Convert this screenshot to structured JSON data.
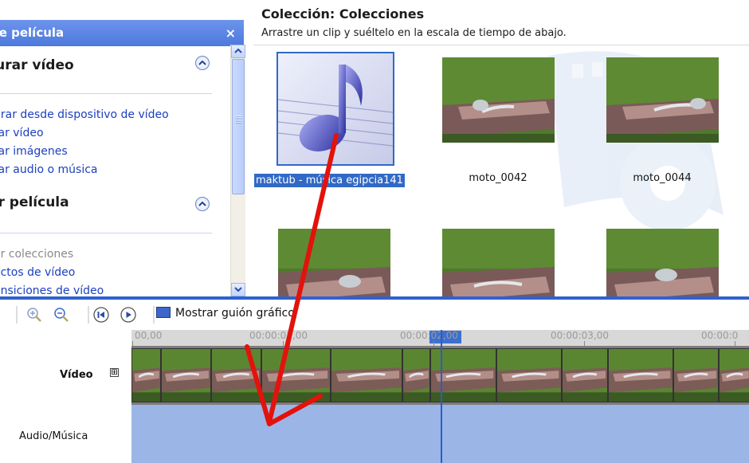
{
  "tasks_pane": {
    "header_title": "de película",
    "close_label": "×",
    "section1": {
      "title": "turar vídeo",
      "items": [
        "urar desde dispositivo de vídeo",
        "tar vídeo",
        "tar imágenes",
        "tar audio o música"
      ]
    },
    "section2": {
      "title": "ar película",
      "items": [
        "ar colecciones",
        "ectos de vídeo",
        "ansiciones de vídeo"
      ]
    }
  },
  "collection": {
    "title": "Colección: Colecciones",
    "subtitle": "Arrastre un clip y suéltelo en la escala de tiempo de abajo.",
    "clips": [
      {
        "name": "maktub - música egipcia141",
        "kind": "audio",
        "selected": true
      },
      {
        "name": "moto_0042",
        "kind": "video"
      },
      {
        "name": "moto_0044",
        "kind": "video"
      },
      {
        "name": "",
        "kind": "video"
      },
      {
        "name": "",
        "kind": "video"
      },
      {
        "name": "",
        "kind": "video"
      }
    ]
  },
  "toolbar": {
    "storyboard_label": "Mostrar guión gráfico"
  },
  "timeline": {
    "ruler_ticks": [
      "00,00",
      "00:00:01,00",
      "00:00:02,00",
      "00:00:03,00",
      "00:00:0"
    ],
    "video_label": "Vídeo",
    "video_expand": "⊞",
    "audio_label": "Audio/Música"
  },
  "colors": {
    "accent": "#3169c6",
    "audio_track": "#9bb6e6",
    "arrow": "#e3120b"
  }
}
